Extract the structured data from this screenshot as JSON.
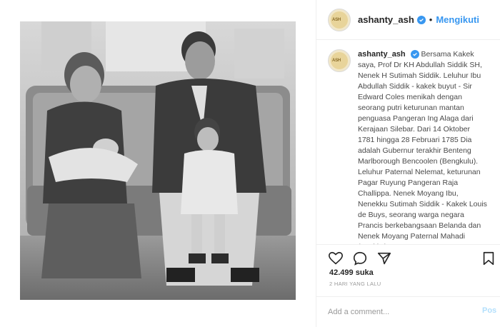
{
  "post": {
    "username": "ashanty_ash",
    "follow_label": "Mengikuti",
    "dot": "•",
    "photo_alt": "Black and white family photo"
  },
  "avatar": {
    "mini_text": "ASH"
  },
  "caption": {
    "username": "ashanty_ash",
    "text": "Bersama Kakek saya, Prof Dr KH Abdullah Siddik SH, Nenek H Sutimah Siddik. Leluhur Ibu Abdullah Siddik - kakek buyut - Sir Edward Coles menikah dengan seorang putri keturunan mantan penguasa Pangeran Ing Alaga dari Kerajaan Silebar. Dari 14 Oktober 1781 hingga 28 Februari 1785 Dia adalah Gubernur terakhir Benteng Marlborough Bencoolen (Bengkulu). Leluhur Paternal Nelemat, keturunan Pagar Ruyung Pangeran Raja Challippa. Nenek Moyang Ibu, Nenekku Sutimah Siddik - Kakek Louis de Buys, seorang warga negara Prancis berkebangsaan Belanda dan Nenek Moyang Paternal Mahadi (Ayah), keturunan Pangeran Ruyung Pangeran, Depati Cap gelar Depati"
  },
  "stats": {
    "likes": "42.499 suka",
    "date": "2 HARI YANG LALU"
  },
  "comment": {
    "placeholder": "Add a comment...",
    "post_label": "Pos"
  },
  "icons": {
    "like": "heart-icon",
    "comment": "comment-icon",
    "share": "share-icon",
    "save": "bookmark-icon",
    "verified": "verified-badge-icon"
  },
  "colors": {
    "accent": "#3897f0",
    "text": "#262626",
    "muted": "#999999",
    "border": "#efefef"
  }
}
